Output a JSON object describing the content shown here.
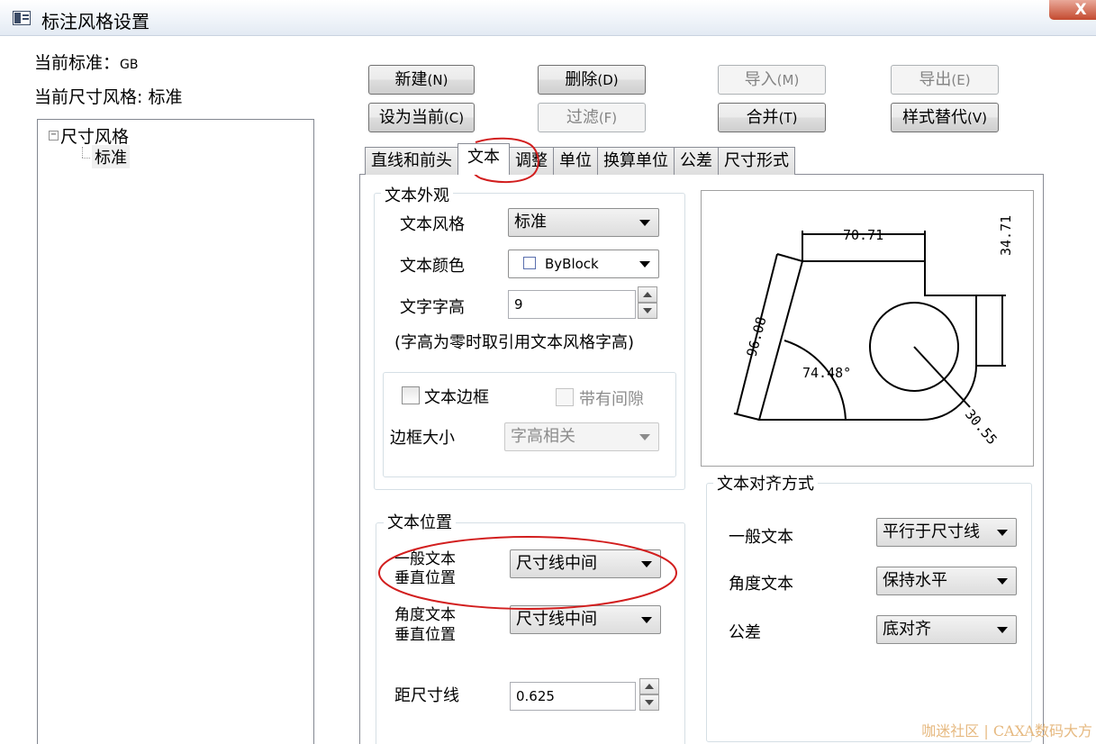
{
  "window": {
    "title": "标注风格设置",
    "close_glyph": "X"
  },
  "info": {
    "standard_label": "当前标准：",
    "standard_value": "GB",
    "style_label": "当前尺寸风格: ",
    "style_value": "标准"
  },
  "tree": {
    "root": "尺寸风格",
    "expander": "−",
    "child": "标准"
  },
  "buttons": {
    "new": {
      "text": "新建",
      "acc": "(N)"
    },
    "delete": {
      "text": "删除",
      "acc": "(D)"
    },
    "import": {
      "text": "导入",
      "acc": "(M)"
    },
    "export": {
      "text": "导出",
      "acc": "(E)"
    },
    "set_current": {
      "text": "设为当前",
      "acc": "(C)"
    },
    "filter": {
      "text": "过滤",
      "acc": "(F)"
    },
    "merge": {
      "text": "合并",
      "acc": "(T)"
    },
    "override": {
      "text": "样式替代",
      "acc": "(V)"
    }
  },
  "tabs": [
    "直线和前头",
    "文本",
    "调整",
    "单位",
    "换算单位",
    "公差",
    "尺寸形式"
  ],
  "text_appearance": {
    "group": "文本外观",
    "style_label": "文本风格",
    "style_value": "标准",
    "color_label": "文本颜色",
    "color_value": "ByBlock",
    "height_label": "文字字高",
    "height_value": "9",
    "height_note": "(字高为零时取引用文本风格字高)",
    "frame_label": "文本边框",
    "gap_label": "带有间隙",
    "frame_size_label": "边框大小",
    "frame_size_value": "字高相关"
  },
  "text_position": {
    "group": "文本位置",
    "general_label_1": "一般文本",
    "general_label_2": "垂直位置",
    "general_value": "尺寸线中间",
    "angle_label_1": "角度文本",
    "angle_label_2": "垂直位置",
    "angle_value": "尺寸线中间",
    "offset_label": "距尺寸线",
    "offset_value": "0.625"
  },
  "text_align": {
    "group": "文本对齐方式",
    "general_label": "一般文本",
    "general_value": "平行于尺寸线",
    "angle_label": "角度文本",
    "angle_value": "保持水平",
    "tolerance_label": "公差",
    "tolerance_value": "底对齐"
  },
  "preview": {
    "dim_top": "70.71",
    "dim_right": "34.71",
    "dim_slant": "96.08",
    "dim_angle": "74.48°",
    "dim_radius": "30.55"
  },
  "colors": {
    "annotation": "#d21e1e",
    "watermark": "#e6b980"
  },
  "watermark": "咖迷社区 | CAXA数码大方"
}
